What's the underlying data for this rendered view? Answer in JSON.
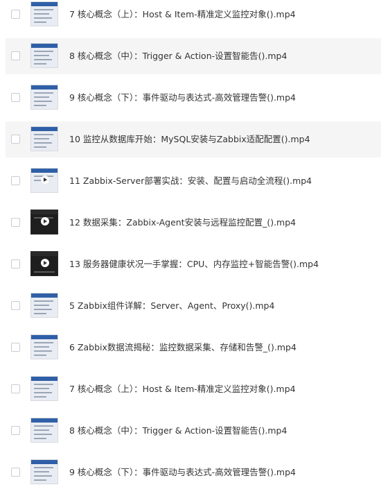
{
  "files": [
    {
      "name": "7 核心概念（上）：Host & Item-精准定义监控对象().mp4",
      "thumbnail_icon": "video-thumbnail-icon"
    },
    {
      "name": "8 核心概念（中）：Trigger & Action-设置智能告().mp4",
      "thumbnail_icon": "video-thumbnail-icon"
    },
    {
      "name": "9 核心概念（下）：事件驱动与表达式-高效管理告警().mp4",
      "thumbnail_icon": "video-thumbnail-icon"
    },
    {
      "name": "10 监控从数据库开始：MySQL安装与Zabbix适配配置().mp4",
      "thumbnail_icon": "video-thumbnail-icon"
    },
    {
      "name": "11 Zabbix-Server部署实战：安装、配置与启动全流程().mp4",
      "thumbnail_icon": "video-thumbnail-icon"
    },
    {
      "name": "12 数据采集：Zabbix-Agent安装与远程监控配置_().mp4",
      "thumbnail_icon": "video-thumbnail-icon"
    },
    {
      "name": "13 服务器健康状况一手掌握：CPU、内存监控+智能告警().mp4",
      "thumbnail_icon": "video-thumbnail-icon"
    },
    {
      "name": "5 Zabbix组件详解：Server、Agent、Proxy().mp4",
      "thumbnail_icon": "video-thumbnail-icon"
    },
    {
      "name": "6 Zabbix数据流揭秘：监控数据采集、存储和告警_().mp4",
      "thumbnail_icon": "video-thumbnail-icon"
    },
    {
      "name": "7 核心概念（上）：Host & Item-精准定义监控对象().mp4",
      "thumbnail_icon": "video-thumbnail-icon"
    },
    {
      "name": "8 核心概念（中）：Trigger & Action-设置智能告().mp4",
      "thumbnail_icon": "video-thumbnail-icon"
    },
    {
      "name": "9 核心概念（下）：事件驱动与表达式-高效管理告警().mp4",
      "thumbnail_icon": "video-thumbnail-icon"
    }
  ],
  "colors": {
    "row_alt_background": "#f5f5f6",
    "text": "#333333",
    "checkbox_border": "#c9ccd1",
    "thumbnail_header": "#2f5fa7"
  }
}
